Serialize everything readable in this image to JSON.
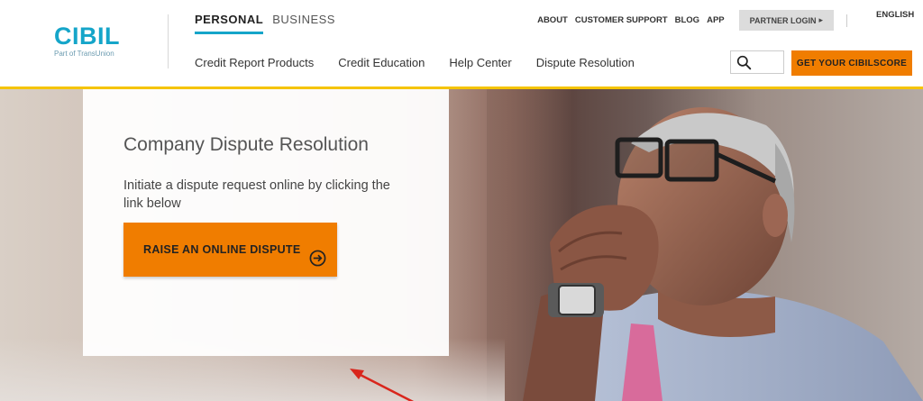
{
  "brand": {
    "name": "CIBIL",
    "tagline": "Part of TransUnion"
  },
  "segment_tabs": [
    {
      "label": "PERSONAL",
      "active": true
    },
    {
      "label": "BUSINESS",
      "active": false
    }
  ],
  "utility_nav": {
    "links": [
      "ABOUT",
      "CUSTOMER SUPPORT",
      "BLOG",
      "APP"
    ],
    "partner_login": "PARTNER LOGIN",
    "language": "ENGLISH"
  },
  "main_nav": [
    "Credit Report Products",
    "Credit Education",
    "Help Center",
    "Dispute Resolution"
  ],
  "search": {
    "placeholder": ""
  },
  "cta": {
    "label": "GET YOUR CIBILSCORE"
  },
  "hero": {
    "title": "Company Dispute Resolution",
    "description": "Initiate a dispute request online by clicking the link below",
    "button_label": "RAISE AN ONLINE DISPUTE"
  },
  "colors": {
    "brand_blue": "#15a5c9",
    "accent_orange": "#f07d00",
    "divider_yellow": "#f5c400",
    "annotation_red": "#d9261c"
  },
  "icons": [
    "search-icon",
    "circle-arrow-right-icon",
    "caret-right-icon"
  ]
}
